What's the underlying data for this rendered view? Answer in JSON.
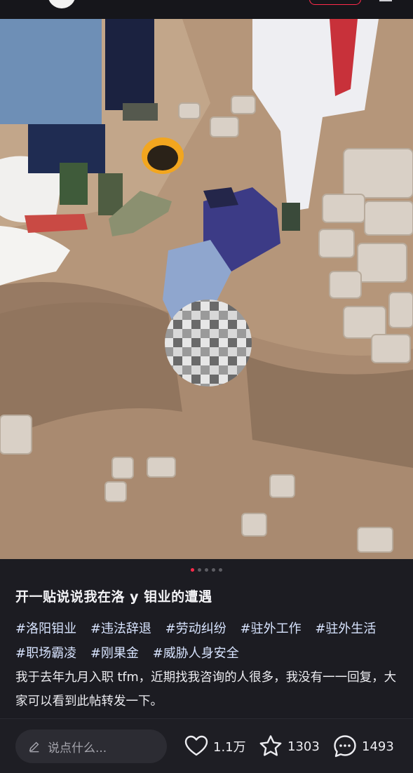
{
  "post": {
    "title": "开一贴说说我在洛 y 钼业的遭遇",
    "tags": [
      "#洛阳钼业",
      "#违法辞退",
      "#劳动纠纷",
      "#驻外工作",
      "#驻外生活",
      "#职场霸凌",
      "#刚果金",
      "#威胁人身安全"
    ],
    "body": "我于去年九月入职 tfm，近期找我咨询的人很多，我没有一一回复，大家可以看到此帖转发一下。"
  },
  "carousel": {
    "total": 5,
    "active": 1
  },
  "bottom_bar": {
    "comment_placeholder": "说点什么...",
    "likes": "1.1万",
    "favorites": "1303",
    "comments": "1493"
  },
  "icons": {
    "pencil": "pencil-icon",
    "like": "heart-icon",
    "favorite": "star-icon",
    "comment": "comment-bubble-icon"
  },
  "colors": {
    "accent": "#ff2a4a",
    "background": "#1c1c22",
    "tag": "#d8e4ff"
  }
}
